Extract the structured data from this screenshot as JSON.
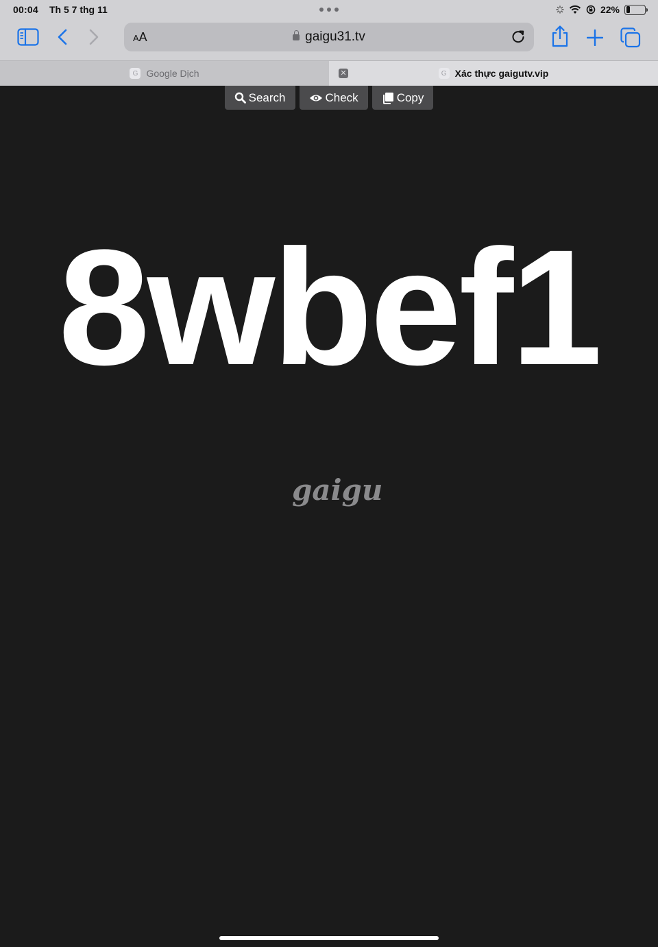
{
  "status_bar": {
    "time": "00:04",
    "date": "Th 5 7 thg 11",
    "battery_percent": "22%",
    "battery_level": 0.22
  },
  "toolbar": {
    "aa_label_small": "A",
    "aa_label_large": "A",
    "url": "gaigu31.tv",
    "icons": [
      "sidebar-icon",
      "back-icon",
      "forward-icon",
      "reload-icon",
      "share-icon",
      "plus-icon",
      "tabs-icon"
    ]
  },
  "tabs": [
    {
      "title": "Google Dịch",
      "favicon": "G",
      "active": false
    },
    {
      "title": "Xác thực gaigutv.vip",
      "favicon": "G",
      "active": true
    }
  ],
  "page": {
    "buttons": [
      {
        "label": "Search",
        "icon": "search-icon"
      },
      {
        "label": "Check",
        "icon": "eye-icon"
      },
      {
        "label": "Copy",
        "icon": "copy-icon"
      }
    ],
    "code": "8wbef1",
    "brand": "gaigu"
  },
  "colors": {
    "page_bg": "#1b1b1b",
    "chrome_bg": "#d1d1d4",
    "accent": "#1a73e8",
    "button_bg": "#4b4b4d"
  }
}
